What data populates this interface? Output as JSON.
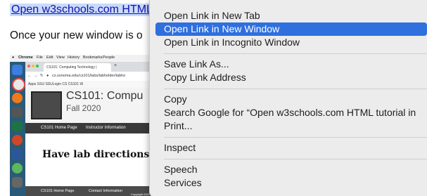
{
  "page": {
    "link_text": "Open w3schools.com HTML",
    "body_text": "Once your new window is o"
  },
  "embedded_screenshot": {
    "mac_menu": [
      "Chrome",
      "File",
      "Edit",
      "View",
      "History",
      "Bookmarks",
      "People"
    ],
    "tab_title": "CS101: Computing Technology |",
    "new_tab": "+",
    "address": "cs.sonoma.edu/cs101/labs/labholder/labho",
    "bookmarks": "Apps  SSU  SSULogin  CS  CS101  W",
    "site_title": "CS101: Compu",
    "site_subtitle": "Fall 2020",
    "nav": [
      "CS101 Home Page",
      "Instructor Information"
    ],
    "lab_heading": "Have lab directions op",
    "footer": [
      "CS101 Home Page",
      "Contact Information",
      "Copyright 2020"
    ]
  },
  "context_menu": {
    "items": [
      {
        "label": "Open Link in New Tab",
        "highlighted": false
      },
      {
        "label": "Open Link in New Window",
        "highlighted": true
      },
      {
        "label": "Open Link in Incognito Window",
        "highlighted": false
      },
      {
        "label": "Save Link As...",
        "highlighted": false
      },
      {
        "label": "Copy Link Address",
        "highlighted": false
      },
      {
        "label": "Copy",
        "highlighted": false
      },
      {
        "label": "Search Google for “Open w3schools.com HTML tutorial in",
        "highlighted": false
      },
      {
        "label": "Print...",
        "highlighted": false
      },
      {
        "label": "Inspect",
        "highlighted": false
      },
      {
        "label": "Speech",
        "highlighted": false
      },
      {
        "label": "Services",
        "highlighted": false
      }
    ],
    "highlight_color": "#2f6fde"
  }
}
